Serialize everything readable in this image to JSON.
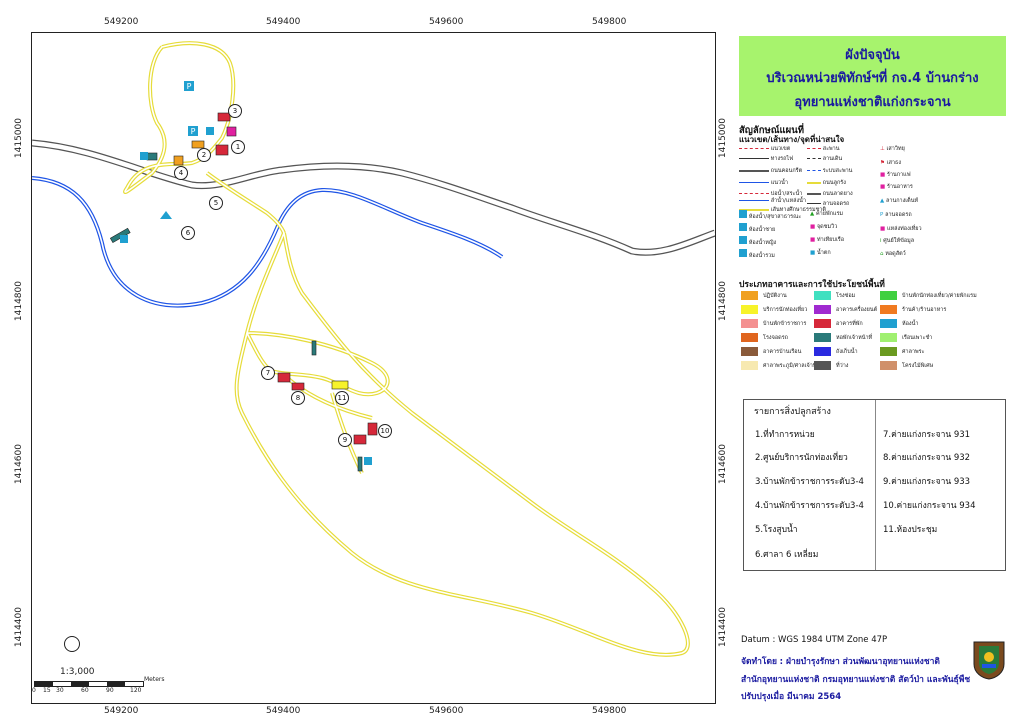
{
  "grid": {
    "x_labels": [
      "549200",
      "549400",
      "549600",
      "549800"
    ],
    "y_labels": [
      "1415000",
      "1414800",
      "1414600",
      "1414400"
    ]
  },
  "title": {
    "line1": "ผังปัจจุบัน",
    "line2": "บริเวณหน่วยพิทักษ์ฯที่ กจ.4 บ้านกร่าง",
    "line3": "อุทยานแห่งชาติแก่งกระจาน",
    "background": "#a7f36d"
  },
  "legend": {
    "heading": "สัญลักษณ์แผนที่",
    "subheading": "แนวเขต/เส้นทาง/จุดที่น่าสนใจ",
    "col1": [
      "แนวเขต",
      "ทางรถไฟ",
      "ถนนคอนกรีต",
      "แนวน้ำ",
      "บ่อน้ำ/สระน้ำ",
      "ลำน้ำ/แหล่งน้ำ",
      "เส้นทางศึกษาธรรมชาติ"
    ],
    "col2": [
      "สะพาน",
      "ลานเดิน",
      "ระบบสะพาน",
      "ถนนลูกรัง",
      "ถนนลาดยาง",
      "ลานจอดรถ"
    ],
    "col3": [
      "เสาวิทยุ",
      "เสาธง",
      "ร้านกาแฟ",
      "ร้านอาหาร",
      "ลานกางเต็นท์",
      "ลานจอดรถ",
      "แหล่งท่องเที่ยว",
      "ศูนย์ให้ข้อมูล",
      "หอดูสัตว์"
    ],
    "icons1": [
      "ห้องน้ำ/สุขาสาธารณะ",
      "ห้องน้ำชาย",
      "ห้องน้ำหญิง",
      "ห้องน้ำรวม"
    ],
    "icons2": [
      "ค่ายพักแรม",
      "จุดชมวิว",
      "ท่าเทียบเรือ",
      "น้ำตก"
    ]
  },
  "landuse": {
    "heading": "ประเภทอาคารและการใช้ประโยชน์พื้นที่",
    "items": [
      {
        "label": "ปฏิบัติงาน",
        "color": "#f0a020"
      },
      {
        "label": "บริการนักท่องเที่ยว",
        "color": "#f7f32a"
      },
      {
        "label": "บ้านพักข้าราชการ",
        "color": "#f49090"
      },
      {
        "label": "โรงจอดรถ",
        "color": "#e0651e"
      },
      {
        "label": "อาคารบ้านเรือน",
        "color": "#8a5a3a"
      },
      {
        "label": "ศาลาพระภูมิ/ศาลเจ้าที่",
        "color": "#f7e9b0"
      },
      {
        "label": "โรงซ่อม",
        "color": "#40e0c0"
      },
      {
        "label": "อาคารเครื่องยนต์",
        "color": "#a02ad0"
      },
      {
        "label": "อาคารที่พัก",
        "color": "#d6283a"
      },
      {
        "label": "หอพักเจ้าหน้าที่",
        "color": "#2a7a7a"
      },
      {
        "label": "ถังเก็บน้ำ",
        "color": "#2a2ae0"
      },
      {
        "label": "ที่ว่าง",
        "color": "#555555"
      },
      {
        "label": "บ้านพักนักท่องเที่ยว/ค่ายพักแรม",
        "color": "#40d040"
      },
      {
        "label": "ร้านค้า/ร้านอาหาร",
        "color": "#f07a20"
      },
      {
        "label": "ห้องน้ำ",
        "color": "#20a0d0"
      },
      {
        "label": "เรือนเพาะชำ",
        "color": "#a0f070"
      },
      {
        "label": "ศาลาพระ",
        "color": "#6a9a20"
      },
      {
        "label": "โครงไม้พิเศษ",
        "color": "#d0906a"
      }
    ]
  },
  "buildings": {
    "heading": "รายการสิ่งปลูกสร้าง",
    "left": [
      "1.ที่ทำการหน่วย",
      "2.ศูนย์บริการนักท่องเที่ยว",
      "3.บ้านพักข้าราชการระดับ3-4",
      "4.บ้านพักข้าราชการระดับ3-4",
      "5.โรงสูบน้ำ",
      "6.ศาลา 6 เหลี่ยม"
    ],
    "right": [
      "7.ค่ายแก่งกระจาน 931",
      "8.ค่ายแก่งกระจาน 932",
      "9.ค่ายแก่งกระจาน 933",
      "10.ค่ายแก่งกระจาน 934",
      "11.ห้องประชุม"
    ]
  },
  "scale": {
    "ratio": "1:3,000",
    "ticks": [
      "0",
      "15",
      "30",
      "60",
      "90",
      "120"
    ],
    "unit": "Meters"
  },
  "credits": {
    "datum": "Datum  : WGS 1984 UTM Zone 47P",
    "by_label": "จัดทำโดย",
    "by_text": ": ฝ่ายบำรุงรักษา ส่วนพัฒนาอุทยานแห่งชาติ",
    "office": "สำนักอุทยานแห่งชาติ  กรมอุทยานแห่งชาติ สัตว์ป่า และพันธุ์พืช",
    "updated": "ปรับปรุงเมื่อ มีนาคม 2564"
  },
  "map_numbers": [
    "1",
    "2",
    "3",
    "4",
    "5",
    "6",
    "7",
    "8",
    "9",
    "10",
    "11"
  ],
  "colors": {
    "trail": "#e6dc3a",
    "road": "#555555",
    "river": "#1f55e6",
    "frame": "#222222"
  }
}
